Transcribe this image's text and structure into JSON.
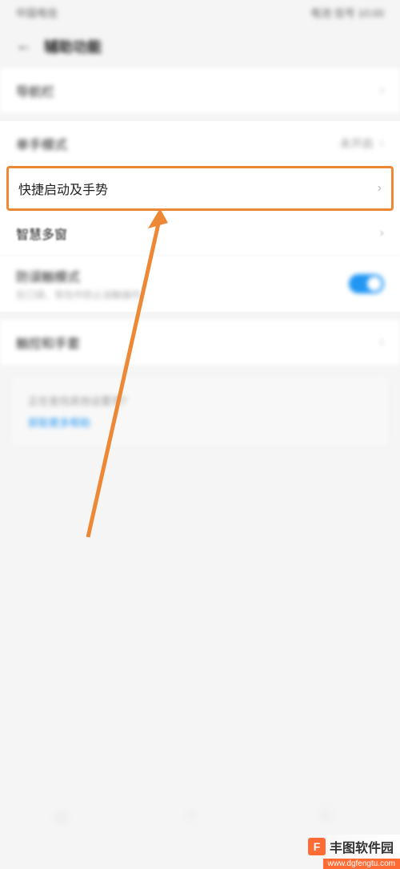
{
  "statusBar": {
    "left": "中国电信",
    "right": "电池 信号 10:00"
  },
  "header": {
    "title": "辅助功能"
  },
  "rows": {
    "nav": {
      "label": "导航栏"
    },
    "oneHand": {
      "label": "单手模式",
      "value": "未开启"
    },
    "shortcuts": {
      "label": "快捷启动及手势"
    },
    "multiWindow": {
      "label": "智慧多窗"
    },
    "gesture": {
      "label": "防误触模式",
      "subtitle": "在口袋、背包中防止误触操作"
    },
    "gloves": {
      "label": "触控和手套"
    }
  },
  "infoBox": {
    "text": "正在查找其他设置项？",
    "link": "获取更多帮助"
  },
  "watermark": {
    "logo": "F",
    "text": "丰图软件园",
    "url": "www.dgfengtu.com"
  }
}
